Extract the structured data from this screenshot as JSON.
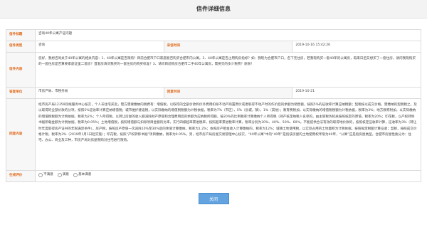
{
  "header": {
    "title": "信件详细信息"
  },
  "letter": {
    "title_label": "信件标题",
    "title_value": "咨询40年公寓产证问题",
    "type_label": "信件类型",
    "type_value": "咨询",
    "time_label": "来信时间",
    "time_value": "2019-10-16 15:42:26",
    "content_label": "信件内容",
    "content_value": "您好，我想咨询关于40年公寓的相关内容：1、40年公寓是否限购？目前合肥市户口家庭能否购买合肥市内公寓。2、40年公寓是否占用购房指标？如：我现为合肥市户口，名下无住房，若我现购买一套40年的公寓房，再来日后又想买了一套住房，请问我现购买的一套住房是否算要家庭证里二套房？首套房请问我买的一套住房的购买标准？3、请问目前购房合肥市二手40年公寓房，需要交的多少税费？谢谢！"
  },
  "reply": {
    "unit_label": "答复单位",
    "unit_value": "市房产局、市税务局",
    "reply_time_label": "回复时间",
    "reply_time_value": "2019-10-21",
    "content_label": "回复内容",
    "content_value": "经市房产局12359热线服务中心核实，个人非住宅买卖，需方需要缴纳的税费有：增值税，以取得的全部价款和价外费用扣除不动产购置原价或者取得不动产时的作价后的余额为销售额，按照5%的征收率计算应纳税额；契税按以成交价格，需缴纳的契税税之，及以取得的全部价款的分项，按照5%征收率计算应纳增值税；城市维护建设税，以实际缴纳的增值税税额为计税依据，税率为7%（市区），5%（县城，镇），1%（其他）；教育费附加，以实际缴纳的增值税税额为计税依据，税率为3%；地方教育附加，以实际缴纳的增值税税额为计税依据，税率为2%；个人所得税，以转让房屋的收入额减除财产原值和合理费用后的余额为应纳税所得额，按20%的比例税率计算缴纳个人所得税（持产核定纳税人名单的，由主管税务机关按照核定的原值，税率为20%；印花税，以产权转移书据所载金额为计税依据，税率为0.05%；土地增值税，按照增值额与扣除项目金额的比率，实行四级超率累进税率，按照超率累进税率计算，税率分别为30%、40%、50%、60%。不能提供合法有效的取得地价款的，按照核定征收率计算，征收率为3%（转让时年度取得房产证书的年限满足条件）。房产税，按照房产原值一次减除10%至30%后的余值计算缴纳，税率为1.2%；依照房产租金收入计算缴纳的，税率为12%；城镇土地使用税，以实际占用的土地面积为计税依据，按照规定税额计算征收；契税，按照成交价格计税，税率为3%（2019年1月1日起实施）；印花税，按照“产权转移书据”项目缴纳，税率为0.05%。另，经市房产局房屋交易管理中心核实，“40年公寓”中的“40年”是指该房屋的土地使用权年限为40年，“公寓”应是指房屋类型。合肥市房屋性质分为：住宅、办公、商业及三种，市房产局对房屋限购对住宅进行限购。"
  },
  "evaluation": {
    "label": "在线评价",
    "options": [
      "不满意",
      "满意",
      "基本满意"
    ]
  },
  "close_label": "关闭"
}
